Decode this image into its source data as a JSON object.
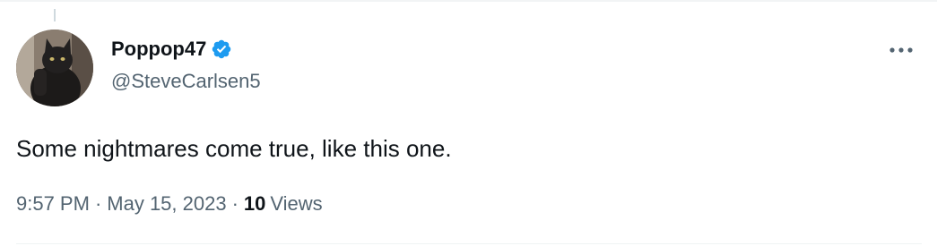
{
  "tweet": {
    "display_name": "Poppop47",
    "handle": "@SteveCarlsen5",
    "verified_icon": "verified-badge-icon",
    "text": "Some nightmares come true, like this one.",
    "time": "9:57 PM",
    "separator": "·",
    "date": "May 15, 2023",
    "views_count": "10",
    "views_label": "Views",
    "more_icon": "more-horizontal-icon"
  },
  "colors": {
    "primary_text": "#0f1419",
    "secondary_text": "#536471",
    "verified_blue": "#1d9bf0",
    "border": "#eff3f4"
  }
}
